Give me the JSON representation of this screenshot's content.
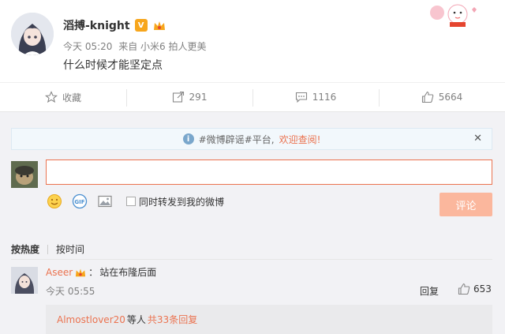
{
  "post": {
    "author": "滔搏-knight",
    "vip_mark": "V",
    "time": "今天 05:20",
    "source": "来自 小米6 拍人更美",
    "text": "什么时候才能坚定点"
  },
  "actions": {
    "favorite_label": "收藏",
    "repost_count": "291",
    "comment_count": "1116",
    "like_count": "5664"
  },
  "notice": {
    "prefix": "#微博辟谣#平台,",
    "link": "欢迎查阅!",
    "close": "✕"
  },
  "composer": {
    "value": "",
    "sync_label": "同时转发到我的微博",
    "submit_label": "评论",
    "gif_label": "GIF"
  },
  "sort": {
    "hot": "按热度",
    "time": "按时间"
  },
  "comment": {
    "user": "Aseer",
    "separator": "：",
    "text": "站在布隆后面",
    "time": "今天 05:55",
    "reply_label": "回复",
    "like_count": "653",
    "sub_user": "Almostlover20",
    "sub_mid": "等人",
    "sub_count": "共33条回复"
  },
  "colors": {
    "accent": "#eb7350",
    "submit_bg": "#fbb79d",
    "area_bg": "#f2f2f5",
    "vip": "#f7a61c"
  }
}
